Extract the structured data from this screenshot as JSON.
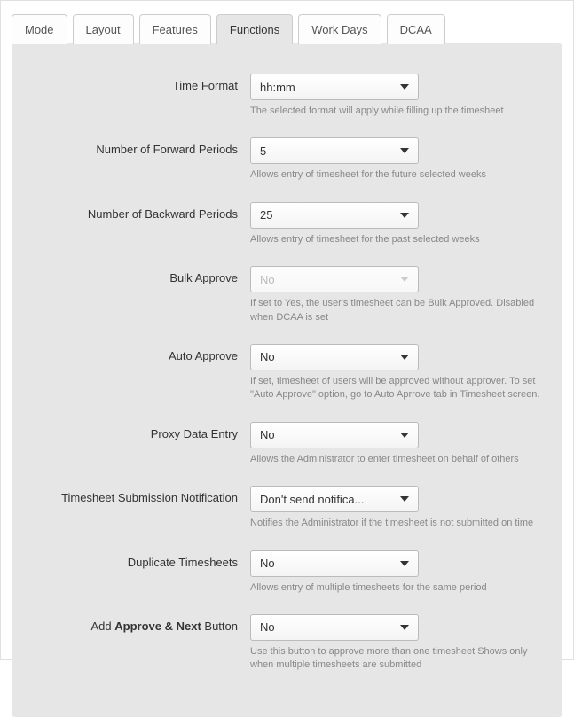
{
  "tabs": {
    "items": [
      {
        "label": "Mode"
      },
      {
        "label": "Layout"
      },
      {
        "label": "Features"
      },
      {
        "label": "Functions"
      },
      {
        "label": "Work Days"
      },
      {
        "label": "DCAA"
      }
    ],
    "active_index": 3
  },
  "fields": {
    "time_format": {
      "label": "Time Format",
      "value": "hh:mm",
      "hint": "The selected format will apply while filling up the timesheet"
    },
    "forward_periods": {
      "label": "Number of Forward Periods",
      "value": "5",
      "hint": "Allows entry of timesheet for the future selected weeks"
    },
    "backward_periods": {
      "label": "Number of Backward Periods",
      "value": "25",
      "hint": "Allows entry of timesheet for the past selected weeks"
    },
    "bulk_approve": {
      "label": "Bulk Approve",
      "value": "No",
      "disabled": true,
      "hint": "If set to Yes, the user's timesheet can be Bulk Approved. Disabled when DCAA is set"
    },
    "auto_approve": {
      "label": "Auto Approve",
      "value": "No",
      "hint": "If set, timesheet of users will be approved without approver. To set \"Auto Approve\" option, go to Auto Aprrove tab in Timesheet screen."
    },
    "proxy_entry": {
      "label": "Proxy Data Entry",
      "value": "No",
      "hint": "Allows the Administrator to enter timesheet on behalf of others"
    },
    "submission_notification": {
      "label": "Timesheet Submission Notification",
      "value": "Don't send notifica...",
      "hint": "Notifies the Administrator if the timesheet is not submitted on time"
    },
    "duplicate_timesheets": {
      "label": "Duplicate Timesheets",
      "value": "No",
      "hint": "Allows entry of multiple timesheets for the same period"
    },
    "approve_next": {
      "label_prefix": "Add ",
      "label_bold": "Approve & Next",
      "label_suffix": " Button",
      "value": "No",
      "hint": "Use this button to approve more than one timesheet Shows only when multiple timesheets are submitted"
    }
  }
}
